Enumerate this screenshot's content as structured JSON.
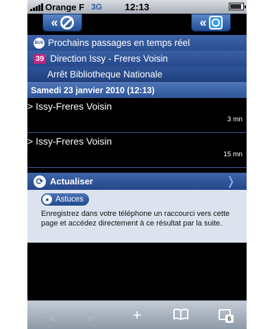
{
  "status": {
    "carrier": "Orange F",
    "network": "3G",
    "time": "12:13"
  },
  "topbar": {
    "back_glyph": "«",
    "left_icon": "no-entry-icon",
    "right_icon": "clock-icon"
  },
  "info": {
    "title": "Prochains passages en temps réel",
    "line_number": "39",
    "direction": "Direction Issy - Freres Voisin",
    "stop": "Arrêt Bibliotheque Nationale",
    "date": "Samedi 23 janvier 2010 (12:13)"
  },
  "departures": [
    {
      "destination": "> Issy-Freres Voisin",
      "wait": "3 mn"
    },
    {
      "destination": "> Issy-Freres Voisin",
      "wait": "15 mn"
    }
  ],
  "refresh": {
    "label": "Actualiser",
    "chevron": "❭"
  },
  "tips": {
    "label": "Astuces",
    "text": "Enregistrez dans votre téléphone un raccourci vers cette page et accédez directement à ce résultat par la suite."
  },
  "toolbar": {
    "back": "◀",
    "forward": "▶",
    "add": "+",
    "bookmarks": "📖",
    "pages_count": "6"
  },
  "colors": {
    "accent_blue": "#2a4e90",
    "line_badge": "#c3257f"
  }
}
